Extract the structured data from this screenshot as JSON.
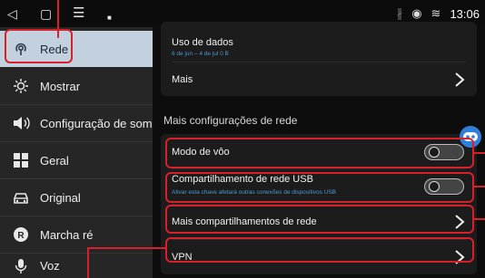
{
  "status_bar": {
    "back_glyph": "◁",
    "home_glyph": "▢",
    "menu_glyph": "☰",
    "dot_glyph": "■",
    "bluetooth_glyph": "∦",
    "location_glyph": "◉",
    "wifi_glyph": "≋",
    "time": "13:06"
  },
  "sidebar": {
    "items": [
      {
        "label": "Rede",
        "icon": "network-icon",
        "glyph": "⊚"
      },
      {
        "label": "Mostrar",
        "icon": "brightness-icon",
        "glyph": "☼"
      },
      {
        "label": "Configuração de som",
        "icon": "speaker-icon",
        "glyph": "◀"
      },
      {
        "label": "Geral",
        "icon": "grid-icon",
        "glyph": "▦"
      },
      {
        "label": "Original",
        "icon": "car-icon",
        "glyph": "⛍"
      },
      {
        "label": "Marcha ré",
        "icon": "reverse-icon",
        "glyph": "R"
      },
      {
        "label": "Voz",
        "icon": "microphone-icon",
        "glyph": "🎙"
      }
    ]
  },
  "main": {
    "data_usage": {
      "title": "Uso de dados",
      "subtitle": "6 de jun – 4 de jul 0 B"
    },
    "more": {
      "title": "Mais"
    },
    "section_title": "Mais configurações de rede",
    "rows": {
      "airplane": {
        "title": "Modo de vôo",
        "on": false
      },
      "usb_tethering": {
        "title": "Compartilhamento de rede USB",
        "subtitle": "Ativar esta chave afetará outras conexões de dispositivos USB",
        "on": false
      },
      "more_tethering": {
        "title": "Mais compartilhamentos de rede"
      },
      "vpn": {
        "title": "VPN"
      }
    }
  },
  "colors": {
    "highlight": "#d8202a",
    "active_item_bg": "#c3d0dd",
    "subtitle_blue": "#4a9ad0"
  }
}
